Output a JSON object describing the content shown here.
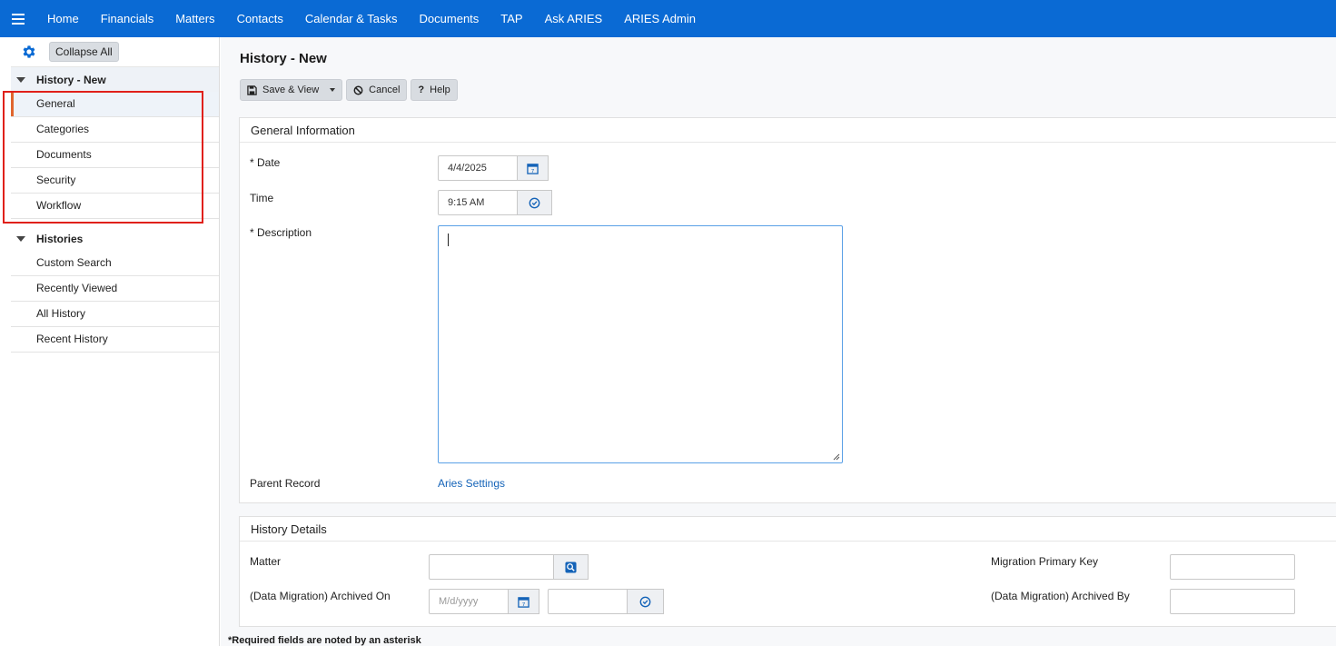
{
  "nav": {
    "items": [
      "Home",
      "Financials",
      "Matters",
      "Contacts",
      "Calendar & Tasks",
      "Documents",
      "TAP",
      "Ask ARIES",
      "ARIES Admin"
    ]
  },
  "sidebar": {
    "collapse_label": "Collapse All",
    "group1": {
      "label": "History - New",
      "items": [
        "General",
        "Categories",
        "Documents",
        "Security",
        "Workflow"
      ]
    },
    "group2": {
      "label": "Histories",
      "items": [
        "Custom Search",
        "Recently Viewed",
        "All History",
        "Recent History"
      ]
    }
  },
  "page": {
    "title": "History - New",
    "toolbar": {
      "save_view": "Save & View",
      "cancel": "Cancel",
      "help": "Help"
    }
  },
  "general": {
    "title": "General Information",
    "date_label": "* Date",
    "date_value": "4/4/2025",
    "time_label": "Time",
    "time_value": "9:15 AM",
    "description_label": "* Description",
    "description_value": "",
    "parent_label": "Parent Record",
    "parent_value": "Aries Settings"
  },
  "details": {
    "title": "History Details",
    "matter_label": "Matter",
    "archived_on_label": "(Data Migration) Archived On",
    "archived_on_placeholder": "M/d/yyyy",
    "migration_key_label": "Migration Primary Key",
    "archived_by_label": "(Data Migration) Archived By"
  },
  "footnote": "*Required fields are noted by an asterisk",
  "colors": {
    "nav": "#0a6ad4",
    "accent_active": "#e0662e",
    "highlight_box": "#e0201a",
    "link": "#1463b8"
  }
}
